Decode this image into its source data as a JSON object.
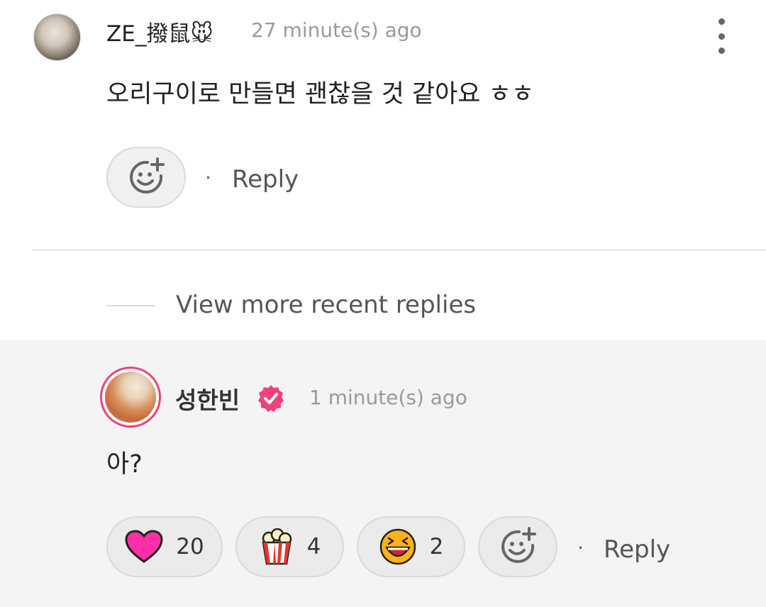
{
  "comment": {
    "username": "ZE_撥鼠🐭",
    "time": "27 minute(s) ago",
    "text": "오리구이로 만들면 괜찮을 것 같아요 ㅎㅎ",
    "separator": "·",
    "reply_label": "Reply"
  },
  "thread": {
    "view_more_label": "View more recent replies"
  },
  "reply": {
    "username": "성한빈",
    "time": "1 minute(s) ago",
    "text": "아?",
    "separator": "·",
    "reply_label": "Reply",
    "reactions": [
      {
        "icon": "heart-icon",
        "count": "20"
      },
      {
        "icon": "popcorn-icon",
        "count": "4"
      },
      {
        "icon": "laughing-face-icon",
        "count": "2"
      }
    ]
  },
  "colors": {
    "accent_pink": "#f0417a",
    "heart": "#ff2fa8"
  }
}
